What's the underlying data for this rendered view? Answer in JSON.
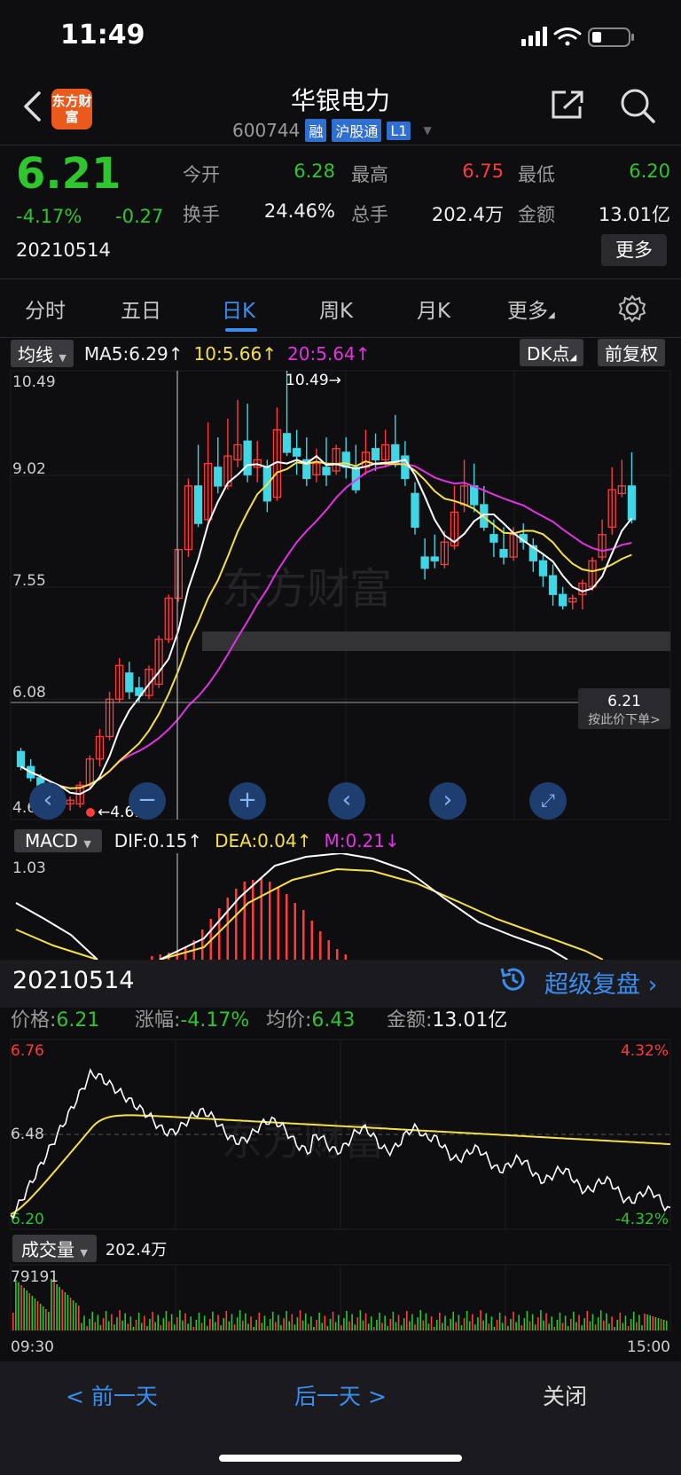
{
  "status_bar": {
    "time": "11:49"
  },
  "header": {
    "title": "华银电力",
    "code": "600744",
    "tags": [
      "融",
      "沪股通",
      "L1"
    ],
    "logo_text": "东方财富"
  },
  "quote": {
    "price": "6.21",
    "change_pct": "-4.17%",
    "change": "-0.27",
    "date": "20210514",
    "fields": [
      {
        "label": "今开",
        "value": "6.28",
        "color": "green"
      },
      {
        "label": "最高",
        "value": "6.75",
        "color": "red"
      },
      {
        "label": "最低",
        "value": "6.20",
        "color": "green"
      },
      {
        "label": "换手",
        "value": "24.46%",
        "color": "white"
      },
      {
        "label": "总手",
        "value": "202.4万",
        "color": "white"
      },
      {
        "label": "金额",
        "value": "13.01亿",
        "color": "white"
      }
    ],
    "more_label": "更多"
  },
  "tabs": [
    "分时",
    "五日",
    "日K",
    "周K",
    "月K",
    "更多"
  ],
  "active_tab": "日K",
  "ma": {
    "selector": "均线",
    "ma5": "MA5:6.29",
    "ma10": "10:5.66",
    "ma20": "20:5.64",
    "dk_label": "DK点",
    "fq_label": "前复权"
  },
  "kline": {
    "y_ticks": [
      "10.49",
      "9.02",
      "7.55",
      "6.08",
      "4.61"
    ],
    "high_marker": "10.49→",
    "low_marker": "←4.61",
    "current_price": "6.21",
    "order_hint": "按此价下单>",
    "watermark": "东方财富"
  },
  "macd": {
    "selector": "MACD",
    "dif": "DIF:0.15",
    "dea": "DEA:0.04",
    "m": "M:0.21",
    "y_top": "1.03"
  },
  "detail": {
    "date": "20210514",
    "replay_label": "超级复盘",
    "price_label": "价格:",
    "price": "6.21",
    "change_label": "涨幅:",
    "change": "-4.17%",
    "avg_label": "均价:",
    "avg": "6.43",
    "amount_label": "金额:",
    "amount": "13.01亿"
  },
  "intraday": {
    "y_top": "6.76",
    "y_mid": "6.48",
    "y_bottom": "6.20",
    "pct_top": "4.32%",
    "pct_bottom": "-4.32%"
  },
  "volume": {
    "selector": "成交量",
    "total": "202.4万",
    "y_top": "79191",
    "time_start": "09:30",
    "time_end": "15:00"
  },
  "bottom": {
    "prev": "< 前一天",
    "next": "后一天 >",
    "close": "关闭"
  },
  "colors": {
    "up": "#ff3b3b",
    "down": "#2ec52e",
    "flat_candle": "#3fd6e6",
    "ma5": "#ffffff",
    "ma10": "#f5e04a",
    "ma20": "#e233e2",
    "accent": "#3a8ef0"
  }
}
